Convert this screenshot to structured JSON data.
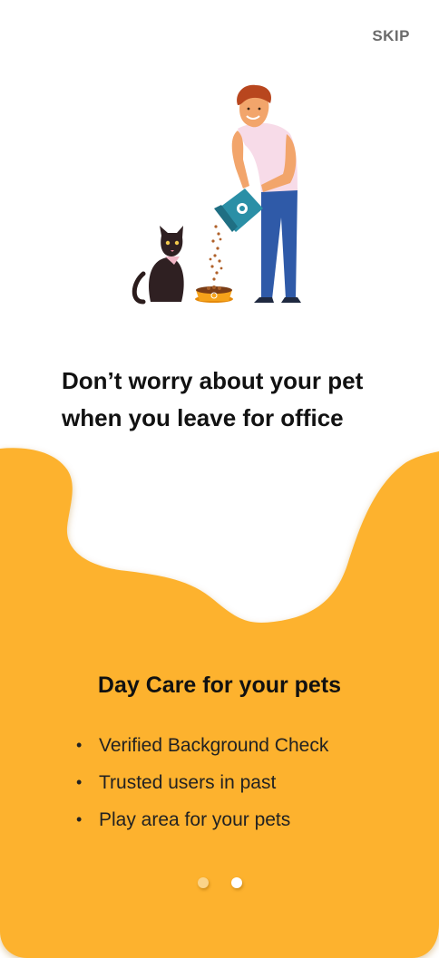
{
  "header": {
    "skip_label": "SKIP"
  },
  "hero": {
    "illustration_icon": "man-feeding-cat-illustration",
    "headline_line1": "Don’t worry about your pet",
    "headline_line2": "when you leave for office"
  },
  "panel": {
    "title": "Day Care for your pets",
    "bullet": "•",
    "features": [
      "Verified Background Check",
      "Trusted users in past",
      "Play area for your pets"
    ]
  },
  "pagination": {
    "total": 2,
    "current": 2
  },
  "colors": {
    "accent": "#fdb22f",
    "accent_light": "#fbd48a",
    "text": "#111111",
    "skip": "#6b6b6b"
  }
}
